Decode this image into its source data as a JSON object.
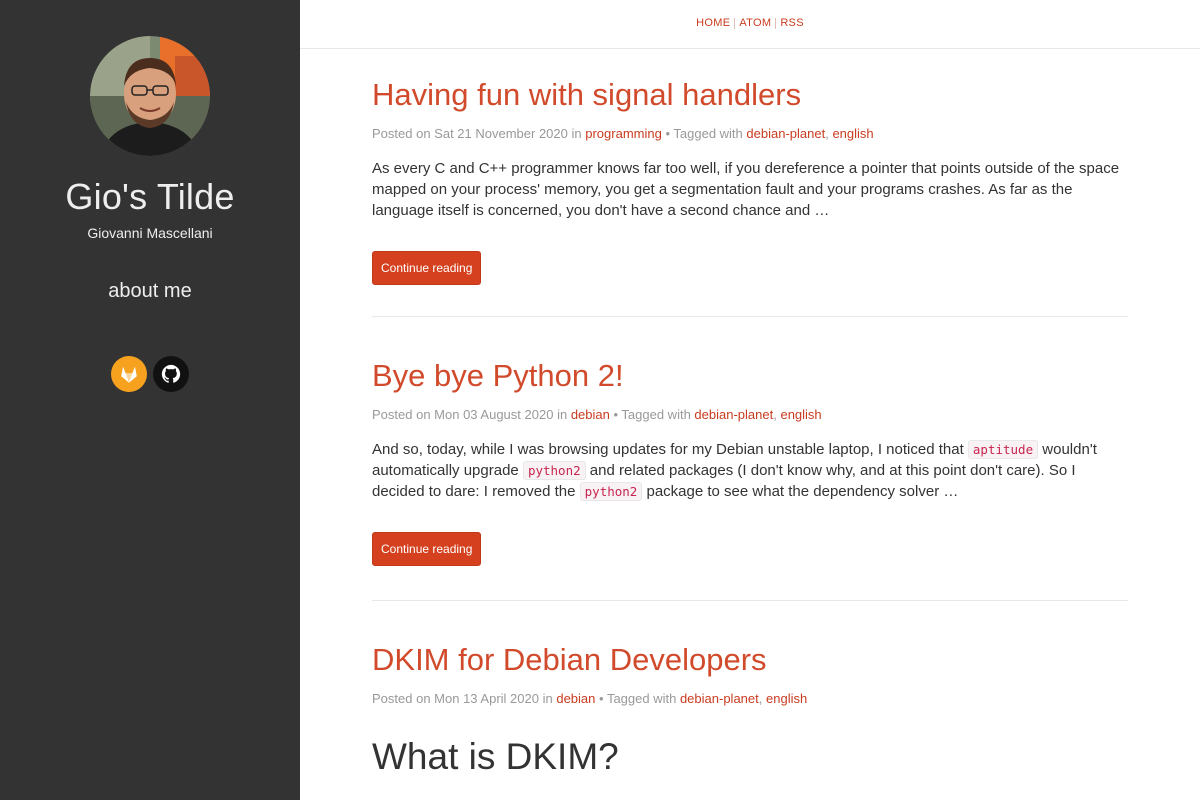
{
  "sidebar": {
    "title": "Gio's Tilde",
    "subtitle": "Giovanni Mascellani",
    "about_label": "about me",
    "social": [
      {
        "name": "gitlab",
        "icon": "gitlab-icon",
        "color": "#f6a21e"
      },
      {
        "name": "github",
        "icon": "github-icon",
        "color": "#111111"
      }
    ]
  },
  "nav": {
    "items": [
      "HOME",
      "ATOM",
      "RSS"
    ]
  },
  "labels": {
    "posted_on": "Posted on",
    "in": "in",
    "tagged_with": "• Tagged with",
    "comma": ",",
    "continue": "Continue reading"
  },
  "posts": [
    {
      "title": "Having fun with signal handlers",
      "date": "Sat 21 November 2020",
      "category": "programming",
      "tags": [
        "debian-planet",
        "english"
      ],
      "summary": "As every C and C++ programmer knows far too well, if you dereference a pointer that points outside of the space mapped on your process' memory, you get a segmentation fault and your programs crashes. As far as the language itself is concerned, you don't have a second chance and …"
    },
    {
      "title": "Bye bye Python 2!",
      "date": "Mon 03 August 2020",
      "category": "debian",
      "tags": [
        "debian-planet",
        "english"
      ],
      "summary_parts": [
        "And so, today, while I was browsing updates for my Debian unstable laptop, I noticed that ",
        "aptitude",
        " wouldn't automatically upgrade ",
        "python2",
        " and related packages (I don't know why, and at this point don't care). So I decided to dare: I removed the ",
        "python2",
        " package to see what the dependency solver …"
      ]
    },
    {
      "title": "DKIM for Debian Developers",
      "date": "Mon 13 April 2020",
      "category": "debian",
      "tags": [
        "debian-planet",
        "english"
      ],
      "heading": "What is DKIM?"
    }
  ],
  "colors": {
    "sidebar_bg": "#333333",
    "accent": "#d14a2b",
    "button": "#d5401e"
  }
}
